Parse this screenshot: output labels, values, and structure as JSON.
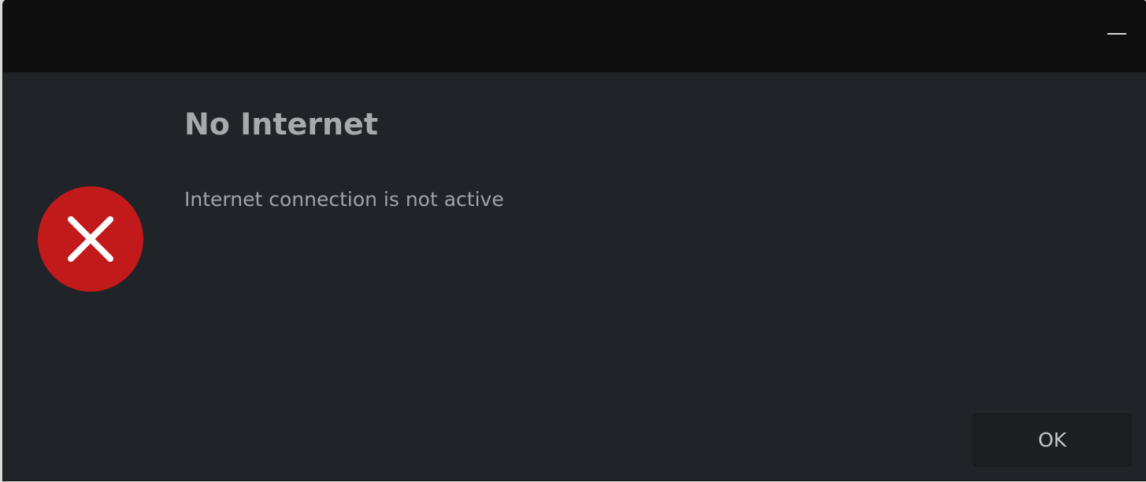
{
  "dialog": {
    "title": "No Internet",
    "message": "Internet connection is not active",
    "ok_label": "OK",
    "icon": "error-icon"
  },
  "titlebar": {
    "minimize_icon": "minimize-icon"
  },
  "colors": {
    "titlebar": "#0f0f0f",
    "body": "#202327",
    "error_red": "#c21a1a",
    "button": "#1d1f22"
  }
}
